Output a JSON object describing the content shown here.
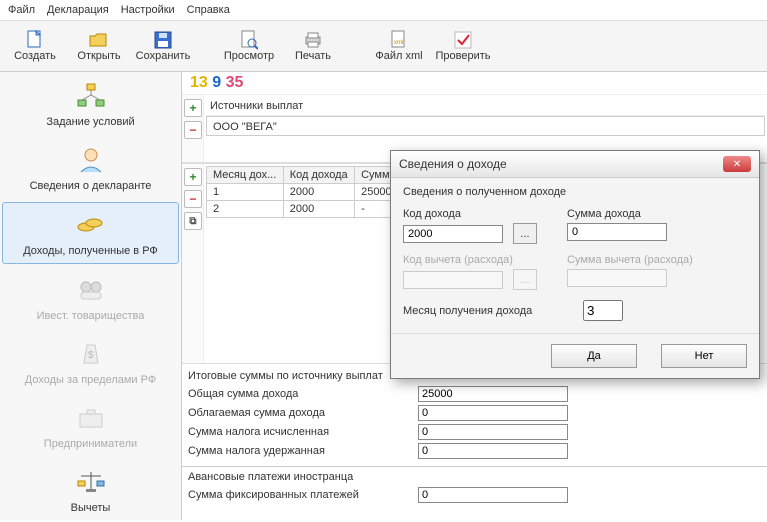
{
  "menu": {
    "file": "Файл",
    "decl": "Декларация",
    "settings": "Настройки",
    "help": "Справка"
  },
  "toolbar": {
    "create": "Создать",
    "open": "Открыть",
    "save": "Сохранить",
    "view": "Просмотр",
    "print": "Печать",
    "xml": "Файл xml",
    "check": "Проверить"
  },
  "nums": {
    "n1": "13",
    "n2": "9",
    "n3": "35"
  },
  "sidebar": {
    "conditions": "Задание условий",
    "declarant": "Сведения о декларанте",
    "income_rf": "Доходы, полученные в РФ",
    "invest": "Ивест. товарищества",
    "income_abroad": "Доходы за пределами РФ",
    "entrepreneurs": "Предприниматели",
    "deductions": "Вычеты"
  },
  "sources": {
    "header": "Источники выплат",
    "item": "ООО \"ВЕГА\""
  },
  "grid": {
    "cols": {
      "month": "Месяц дох...",
      "code": "Код дохода",
      "sum": "Сумм..."
    },
    "rows": [
      {
        "month": "1",
        "code": "2000",
        "sum": "25000"
      },
      {
        "month": "2",
        "code": "2000",
        "sum": "-"
      }
    ]
  },
  "totals": {
    "title": "Итоговые суммы по источнику выплат",
    "total_income_lbl": "Общая сумма дохода",
    "total_income": "25000",
    "taxable_lbl": "Облагаемая сумма дохода",
    "taxable": "0",
    "tax_calc_lbl": "Сумма налога исчисленная",
    "tax_calc": "0",
    "tax_withheld_lbl": "Сумма налога удержанная",
    "tax_withheld": "0"
  },
  "advance": {
    "title": "Авансовые платежи иностранца",
    "fixed_lbl": "Сумма фиксированных платежей",
    "fixed": "0"
  },
  "dialog": {
    "title": "Сведения о доходе",
    "group": "Сведения о полученном доходе",
    "code_lbl": "Код дохода",
    "code": "2000",
    "sum_lbl": "Сумма дохода",
    "sum": "0",
    "ded_code_lbl": "Код вычета (расхода)",
    "ded_code": "",
    "ded_sum_lbl": "Сумма вычета (расхода)",
    "ded_sum": "",
    "month_lbl": "Месяц получения дохода",
    "month": "3",
    "ok": "Да",
    "cancel": "Нет"
  },
  "icons": {
    "plus": "+",
    "minus": "−",
    "dup": "⧉",
    "ellipsis": "...",
    "close": "✕"
  }
}
